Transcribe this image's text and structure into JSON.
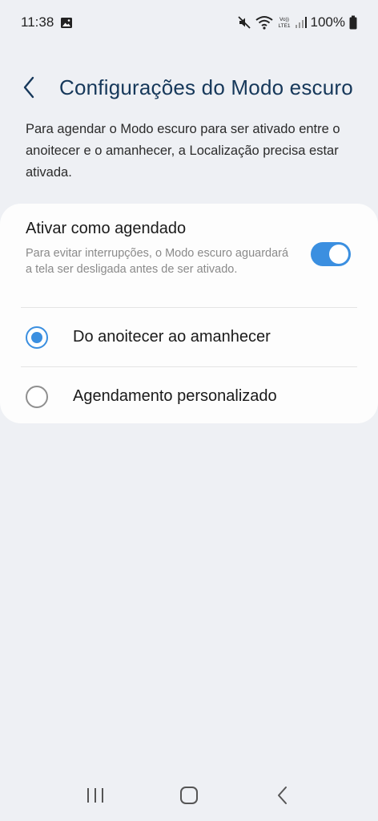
{
  "status_bar": {
    "time": "11:38",
    "battery_percent": "100%",
    "icons": [
      "gallery-notification-icon",
      "mute-icon",
      "wifi-icon",
      "volte-lte-icon",
      "signal-icon",
      "battery-icon"
    ]
  },
  "header": {
    "title": "Configurações do Modo escuro",
    "back_icon": "chevron-left-icon"
  },
  "description": "Para agendar o Modo escuro para ser ativado entre o anoitecer e o amanhecer, a Localização precisa estar ativada.",
  "schedule": {
    "title": "Ativar como agendado",
    "subtitle": "Para evitar interrupções, o Modo escuro aguardará a tela ser desligada antes de ser ativado.",
    "enabled": true
  },
  "options": [
    {
      "label": "Do anoitecer ao amanhecer",
      "selected": true
    },
    {
      "label": "Agendamento personalizado",
      "selected": false
    }
  ],
  "nav_bar": {
    "icons": [
      "recent-apps-icon",
      "home-icon",
      "back-icon"
    ]
  },
  "colors": {
    "accent": "#3b8fe0",
    "title": "#16385a",
    "background": "#eef0f4",
    "card": "#fdfdfd"
  }
}
